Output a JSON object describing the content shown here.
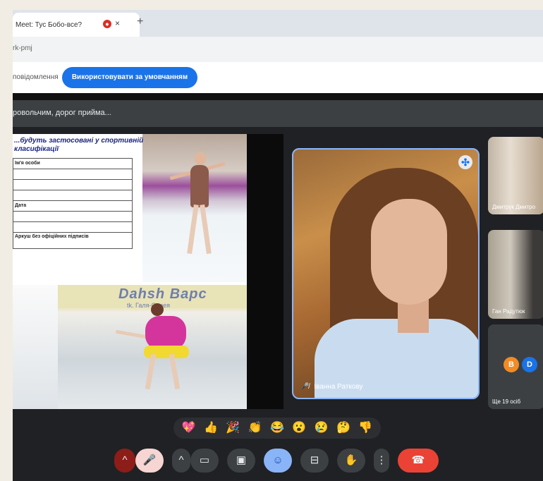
{
  "browser": {
    "tab_title": "Meet: Тус Бобо-все?",
    "tab_audio_icon": "●",
    "tab_close_icon": "×",
    "new_tab_icon": "+",
    "address": "rk-pmj"
  },
  "notification": {
    "text": "повідомлення",
    "button_label": "Використовувати за умовчанням"
  },
  "caption": {
    "text": "ровольчим, дорог прийма..."
  },
  "slide": {
    "title": "...будуть застосовані у спортивній класифікації",
    "form_rows": [
      "Ім'я особи",
      "",
      "",
      "",
      "Дата",
      "",
      "",
      "Аркуш без офіційних підписів"
    ],
    "banner": "Dahsh Bapc",
    "banner_sub": "tk. Галя-Сарея"
  },
  "main_tile": {
    "name": "Іванна Раткову",
    "pin_icon": "✣",
    "mic_off_icon": "🎤̸"
  },
  "side_tiles": [
    {
      "name": "Дмитрук Дмитро"
    },
    {
      "name": "Ган Радутюк"
    },
    {
      "name": "Ще 19 осіб",
      "avatars": [
        "B",
        "D"
      ]
    }
  ],
  "reactions": [
    "💖",
    "👍",
    "🎉",
    "👏",
    "😂",
    "😮",
    "😢",
    "🤔",
    "👎"
  ],
  "controls": {
    "mic_options": "^",
    "mic": "🎤",
    "cam_options": "^",
    "cam": "▭",
    "captions": "▣",
    "emoji": "☺",
    "present": "⊟",
    "hand": "✋",
    "more": "⋮",
    "end_call": "☎"
  },
  "colors": {
    "accent": "#1a73e8",
    "end_call": "#ea4335",
    "meet_bg": "#202124",
    "tile_border": "#8ab4f8"
  }
}
